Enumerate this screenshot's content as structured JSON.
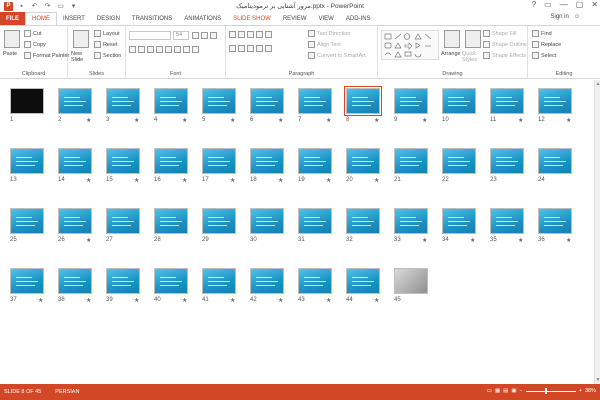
{
  "window": {
    "title": "مرور آشنایی بر ترمودینامیک.pptx - PowerPoint",
    "controls": [
      "?",
      "▭",
      "—",
      "▢",
      "✕"
    ]
  },
  "ribbon_tabs": [
    "FILE",
    "HOME",
    "INSERT",
    "DESIGN",
    "TRANSITIONS",
    "ANIMATIONS",
    "SLIDE SHOW",
    "REVIEW",
    "VIEW",
    "ADD-INS"
  ],
  "signin": "Sign in",
  "clipboard": {
    "paste": "Paste",
    "cut": "Cut",
    "copy": "Copy",
    "format_painter": "Format Painter",
    "label": "Clipboard"
  },
  "slides_group": {
    "new_slide": "New Slide",
    "layout": "Layout",
    "reset": "Reset",
    "section": "Section",
    "label": "Slides"
  },
  "font_group": {
    "font_size": "54",
    "label": "Font"
  },
  "paragraph_group": {
    "text_direction": "Text Direction",
    "align_text": "Align Text",
    "convert_smartart": "Convert to SmartArt",
    "label": "Paragraph"
  },
  "drawing_group": {
    "arrange": "Arrange",
    "quick_styles": "Quick Styles",
    "shape_fill": "Shape Fill",
    "shape_outline": "Shape Outline",
    "shape_effects": "Shape Effects",
    "label": "Drawing"
  },
  "editing_group": {
    "find": "Find",
    "replace": "Replace",
    "select": "Select",
    "label": "Editing"
  },
  "slides": [
    {
      "n": "1",
      "star": ""
    },
    {
      "n": "2",
      "star": "★"
    },
    {
      "n": "3",
      "star": "★"
    },
    {
      "n": "4",
      "star": "★"
    },
    {
      "n": "5",
      "star": "★"
    },
    {
      "n": "6",
      "star": "★"
    },
    {
      "n": "7",
      "star": "★"
    },
    {
      "n": "8",
      "star": "★"
    },
    {
      "n": "9",
      "star": "★"
    },
    {
      "n": "10",
      "star": ""
    },
    {
      "n": "11",
      "star": "★"
    },
    {
      "n": "12",
      "star": "★"
    },
    {
      "n": "13",
      "star": ""
    },
    {
      "n": "14",
      "star": "★"
    },
    {
      "n": "15",
      "star": "★"
    },
    {
      "n": "16",
      "star": "★"
    },
    {
      "n": "17",
      "star": "★"
    },
    {
      "n": "18",
      "star": "★"
    },
    {
      "n": "19",
      "star": "★"
    },
    {
      "n": "20",
      "star": "★"
    },
    {
      "n": "21",
      "star": ""
    },
    {
      "n": "22",
      "star": ""
    },
    {
      "n": "23",
      "star": ""
    },
    {
      "n": "24",
      "star": ""
    },
    {
      "n": "25",
      "star": ""
    },
    {
      "n": "26",
      "star": "★"
    },
    {
      "n": "27",
      "star": ""
    },
    {
      "n": "28",
      "star": ""
    },
    {
      "n": "29",
      "star": ""
    },
    {
      "n": "30",
      "star": ""
    },
    {
      "n": "31",
      "star": ""
    },
    {
      "n": "32",
      "star": ""
    },
    {
      "n": "33",
      "star": "★"
    },
    {
      "n": "34",
      "star": "★"
    },
    {
      "n": "35",
      "star": "★"
    },
    {
      "n": "36",
      "star": "★"
    },
    {
      "n": "37",
      "star": "★"
    },
    {
      "n": "38",
      "star": "★"
    },
    {
      "n": "39",
      "star": "★"
    },
    {
      "n": "40",
      "star": "★"
    },
    {
      "n": "41",
      "star": "★"
    },
    {
      "n": "42",
      "star": "★"
    },
    {
      "n": "43",
      "star": "★"
    },
    {
      "n": "44",
      "star": "★"
    },
    {
      "n": "45",
      "star": ""
    }
  ],
  "status": {
    "slide_info": "SLIDE 8 OF 45",
    "language": "PERSIAN",
    "zoom": "38%"
  },
  "colors": {
    "accent": "#d24726",
    "slide_bg": "#2aa5d6"
  }
}
